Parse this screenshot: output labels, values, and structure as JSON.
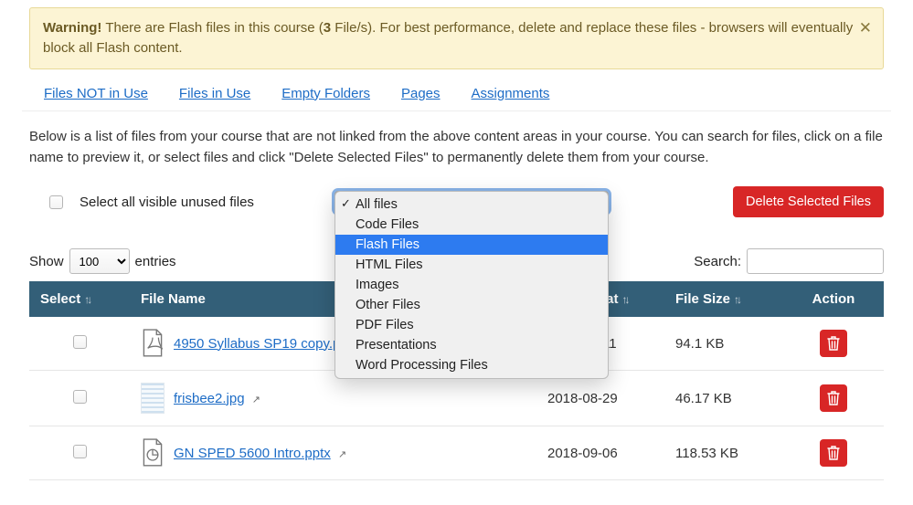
{
  "alert": {
    "strong": "Warning!",
    "before_count": " There are Flash files in this course (",
    "count_strong": "3",
    "after_count": " File/s). For best performance, delete and replace these files - browsers will eventually block all Flash content."
  },
  "tabs": [
    "Files NOT in Use",
    "Files in Use",
    "Empty Folders",
    "Pages",
    "Assignments"
  ],
  "intro": "Below is a list of files from your course that are not linked from the above content areas in your course. You can search for files, click on a file name to preview it, or select files and click \"Delete Selected Files\" to permanently delete them from your course.",
  "toolbar": {
    "select_all_label": "Select all visible unused files",
    "delete_button": "Delete Selected Files"
  },
  "filter": {
    "options": [
      {
        "label": "All files",
        "selected": true,
        "highlight": false
      },
      {
        "label": "Code Files",
        "selected": false,
        "highlight": false
      },
      {
        "label": "Flash Files",
        "selected": false,
        "highlight": true
      },
      {
        "label": "HTML Files",
        "selected": false,
        "highlight": false
      },
      {
        "label": "Images",
        "selected": false,
        "highlight": false
      },
      {
        "label": "Other Files",
        "selected": false,
        "highlight": false
      },
      {
        "label": "PDF Files",
        "selected": false,
        "highlight": false
      },
      {
        "label": "Presentations",
        "selected": false,
        "highlight": false
      },
      {
        "label": "Word Processing Files",
        "selected": false,
        "highlight": false
      }
    ]
  },
  "table_controls": {
    "show_label": "Show",
    "entries_value": "100",
    "entries_label": "entries",
    "search_label": "Search:"
  },
  "columns": {
    "select": "Select",
    "filename": "File Name",
    "updated": "Updated at",
    "size": "File Size",
    "action": "Action"
  },
  "rows": [
    {
      "icon": "pdf",
      "name": "4950 Syllabus SP19 copy.pdf",
      "updated": "2018-12-11",
      "size": "94.1 KB"
    },
    {
      "icon": "image",
      "name": "frisbee2.jpg",
      "updated": "2018-08-29",
      "size": "46.17 KB"
    },
    {
      "icon": "pptx",
      "name": "GN SPED 5600 Intro.pptx",
      "updated": "2018-09-06",
      "size": "118.53 KB"
    }
  ]
}
